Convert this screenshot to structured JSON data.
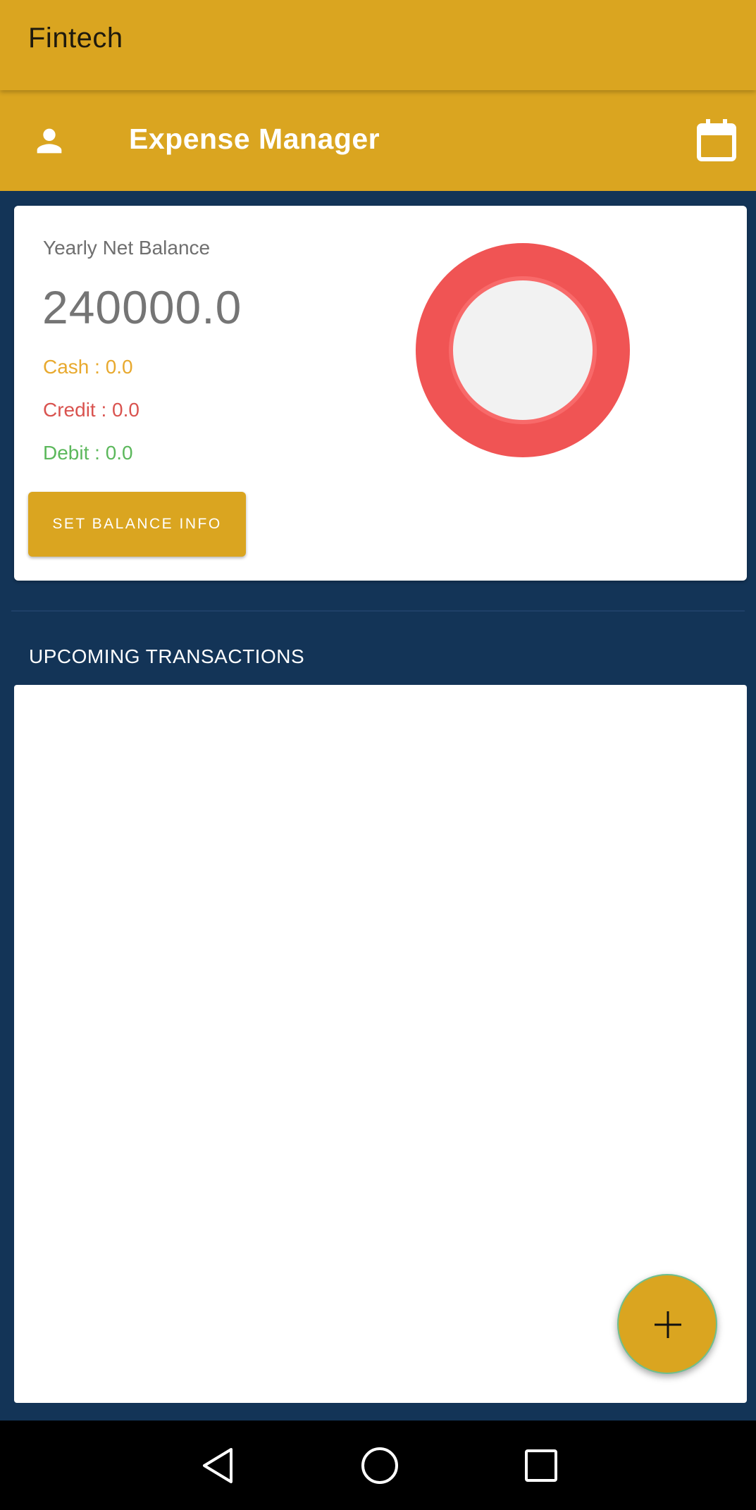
{
  "app_bar": {
    "title": "Fintech"
  },
  "toolbar": {
    "title": "Expense Manager",
    "left_icon": "person-icon",
    "right_icon": "calendar-icon"
  },
  "balance_card": {
    "heading": "Yearly Net Balance",
    "amount": "240000.0",
    "cash": "Cash : 0.0",
    "credit": "Credit : 0.0",
    "debit": "Debit : 0.0",
    "button_label": "SET BALANCE INFO"
  },
  "chart_data": {
    "type": "pie",
    "categories": [],
    "values": [],
    "colors": {
      "ring": "#F05454",
      "inner_ring": "#F86A6A",
      "center": "#F2F2F2"
    }
  },
  "transactions": {
    "title": "UPCOMING TRANSACTIONS",
    "items": []
  },
  "fab": {
    "icon": "plus-icon"
  },
  "nav_bar": {
    "icons": [
      "back-icon",
      "home-icon",
      "recents-icon"
    ]
  },
  "colors": {
    "primary": "#DAA520",
    "background": "#133457",
    "cash": "#E8A92E",
    "credit": "#D9534F",
    "debit": "#5CB85C"
  }
}
